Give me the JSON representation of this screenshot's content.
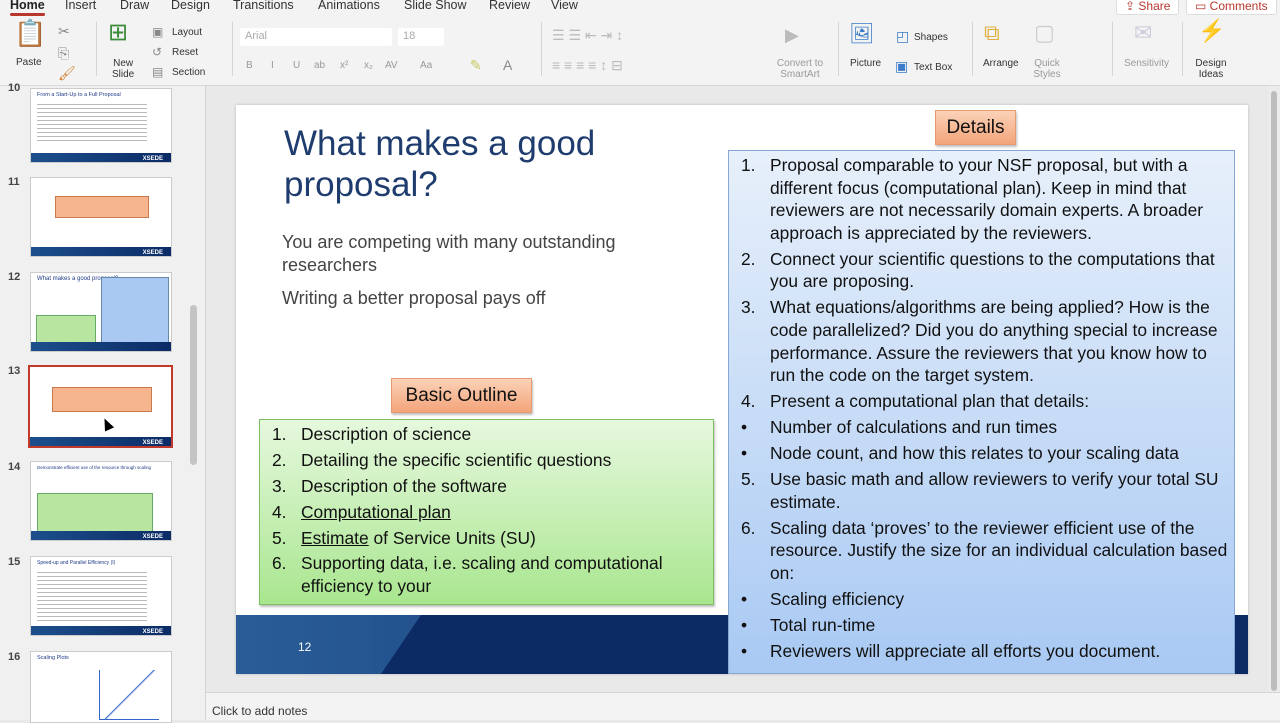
{
  "tabs": [
    "Home",
    "Insert",
    "Draw",
    "Design",
    "Transitions",
    "Animations",
    "Slide Show",
    "Review",
    "View"
  ],
  "active_tab": "Home",
  "top_buttons": {
    "share": "Share",
    "comments": "Comments"
  },
  "ribbon": {
    "paste": "Paste",
    "new_slide": "New\nSlide",
    "layout": "Layout",
    "reset": "Reset",
    "section": "Section",
    "font_name": "Arial",
    "font_size": "18",
    "bold": "B",
    "italic": "I",
    "underline": "U",
    "strike": "ab",
    "superscript": "x²",
    "subscript": "x₂",
    "spacing": "AV",
    "case": "Aa",
    "convert_smartart": "Convert to SmartArt",
    "picture": "Picture",
    "shapes": "Shapes",
    "text_box": "Text Box",
    "arrange": "Arrange",
    "quick_styles": "Quick Styles",
    "sensitivity": "Sensitivity",
    "design_ideas": "Design Ideas"
  },
  "thumbnails": [
    {
      "num": "10",
      "title": "From a Start-Up to a Full Proposal",
      "logo": "XSEDE"
    },
    {
      "num": "11",
      "title": "",
      "logo": "XSEDE"
    },
    {
      "num": "12",
      "title": "What makes a good proposal?",
      "logo": ""
    },
    {
      "num": "13",
      "title": "",
      "logo": "XSEDE",
      "selected": true
    },
    {
      "num": "14",
      "title": "Demonstrate efficient use of the resource through scaling",
      "logo": "XSEDE"
    },
    {
      "num": "15",
      "title": "Speed-up and Parallel Efficiency (I)",
      "logo": "XSEDE"
    },
    {
      "num": "16",
      "title": "Scaling Plots",
      "logo": ""
    }
  ],
  "slide": {
    "title": "What makes a good proposal?",
    "subtitle1": "You are competing with many outstanding researchers",
    "subtitle2": "Writing a better proposal pays off",
    "outline_label": "Basic Outline",
    "outline": [
      {
        "m": "1.",
        "t": "Description of science"
      },
      {
        "m": "2.",
        "t": "Detailing the specific scientific questions"
      },
      {
        "m": "3.",
        "t": "Description of the software"
      },
      {
        "m": "4.",
        "u": "Computational plan",
        "t": ""
      },
      {
        "m": "5.",
        "u": "Estimate",
        "t": " of Service Units (SU)"
      },
      {
        "m": "6.",
        "t": "Supporting data, i.e. scaling and computational efficiency to your"
      }
    ],
    "details_label": "Details",
    "details": [
      {
        "m": "1.",
        "t": "Proposal comparable to your NSF proposal, but with a different focus (computational plan). Keep in mind that reviewers are not  necessarily domain experts. A broader approach is appreciated by the reviewers."
      },
      {
        "m": "2.",
        "t": "Connect your scientific questions to the computations that you are proposing."
      },
      {
        "m": "3.",
        "t": "What equations/algorithms are being applied? How is the code parallelized? Did you do anything special to increase performance. Assure the reviewers that you know how to run the code on the target system."
      },
      {
        "m": "4.",
        "t": "Present a computational plan that details:"
      },
      {
        "m": "•",
        "t": "Number of calculations and run times"
      },
      {
        "m": "•",
        "t": "Node count, and how this relates to your scaling data"
      },
      {
        "m": "5.",
        "t": "Use basic math and allow reviewers to verify your total SU estimate."
      },
      {
        "m": "6.",
        "t": "Scaling data ‘proves’ to the reviewer efficient use of the resource. Justify the size for an individual calculation based on:"
      },
      {
        "m": "•",
        "t": "Scaling efficiency"
      },
      {
        "m": "•",
        "t": "Total run-time"
      },
      {
        "m": "•",
        "t": "Reviewers will appreciate all efforts you document."
      }
    ],
    "page_number": "12"
  },
  "notes_placeholder": "Click to add notes"
}
